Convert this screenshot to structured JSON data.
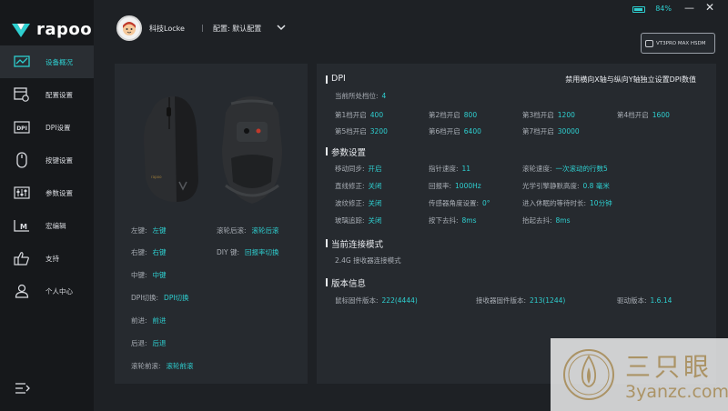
{
  "app": {
    "brand": "rapoo"
  },
  "sidebar": {
    "items": [
      {
        "label": "设备概况",
        "icon": "overview-chart-icon",
        "active": true
      },
      {
        "label": "配置设置",
        "icon": "config-settings-icon",
        "active": false
      },
      {
        "label": "DPI设置",
        "icon": "dpi-icon",
        "active": false
      },
      {
        "label": "按键设置",
        "icon": "mouse-icon",
        "active": false
      },
      {
        "label": "参数设置",
        "icon": "sliders-icon",
        "active": false
      },
      {
        "label": "宏编辑",
        "icon": "macro-m-icon",
        "active": false
      },
      {
        "label": "支持",
        "icon": "thumbs-up-icon",
        "active": false
      },
      {
        "label": "个人中心",
        "icon": "user-icon",
        "active": false
      }
    ]
  },
  "header": {
    "username": "科技Locke",
    "separator": "|",
    "config_label": "配置: 默认配置",
    "battery": "84%",
    "minimize": "—",
    "close": "✕",
    "device": "VT3PRO MAX HSDM"
  },
  "mouse": {
    "left_buttons": [
      {
        "key": "左键:",
        "value": "左键"
      },
      {
        "key": "右键:",
        "value": "右键"
      },
      {
        "key": "中键:",
        "value": "中键"
      },
      {
        "key": "DPI切换:",
        "value": "DPI切换"
      },
      {
        "key": "前进:",
        "value": "前进"
      },
      {
        "key": "后退:",
        "value": "后退"
      },
      {
        "key": "滚轮前滚:",
        "value": "滚轮前滚"
      }
    ],
    "right_buttons": [
      {
        "key": "滚轮后滚:",
        "value": "滚轮后滚"
      },
      {
        "key": "DIY 键:",
        "value": "回报率切换"
      }
    ]
  },
  "dpi": {
    "title": "DPI",
    "toggle_text": "禁用横向X轴与纵向Y轴独立设置DPI数值",
    "current_label": "当前所处档位:",
    "current_value": "4",
    "levels": [
      {
        "label": "第1档开启",
        "value": "400"
      },
      {
        "label": "第2档开启",
        "value": "800"
      },
      {
        "label": "第3档开启",
        "value": "1200"
      },
      {
        "label": "第4档开启",
        "value": "1600"
      },
      {
        "label": "第5档开启",
        "value": "3200"
      },
      {
        "label": "第6档开启",
        "value": "6400"
      },
      {
        "label": "第7档开启",
        "value": "30000"
      }
    ]
  },
  "params": {
    "title": "参数设置",
    "rows": [
      [
        {
          "key": "移动同步:",
          "value": "开启"
        },
        {
          "key": "指针速度:",
          "value": "11"
        },
        {
          "key": "滚轮速度:",
          "value": "一次滚动的行数5"
        }
      ],
      [
        {
          "key": "直线修正:",
          "value": "关闭"
        },
        {
          "key": "回报率:",
          "value": "1000Hz"
        },
        {
          "key": "光学引擎静默高度:",
          "value": "0.8 毫米"
        }
      ],
      [
        {
          "key": "波纹修正:",
          "value": "关闭"
        },
        {
          "key": "传感器角度设置:",
          "value": "0°"
        },
        {
          "key": "进入休眠的等待时长:",
          "value": "10分钟"
        }
      ],
      [
        {
          "key": "玻璃追踪:",
          "value": "关闭"
        },
        {
          "key": "按下去抖:",
          "value": "8ms"
        },
        {
          "key": "抬起去抖:",
          "value": "8ms"
        }
      ]
    ]
  },
  "connection": {
    "title": "当前连接模式",
    "mode": "2.4G 接收器连接模式"
  },
  "version": {
    "title": "版本信息",
    "items": [
      {
        "key": "鼠标固件版本:",
        "value": "222(4444)"
      },
      {
        "key": "接收器固件版本:",
        "value": "213(1244)"
      },
      {
        "key": "驱动版本:",
        "value": "1.6.14"
      }
    ]
  },
  "watermark": {
    "cn": "三只眼",
    "url": "3yanzc.com"
  },
  "colors": {
    "accent": "#2ecfd0",
    "panel": "#262a2f",
    "background": "#1e2125",
    "sidebar": "#16181b"
  }
}
